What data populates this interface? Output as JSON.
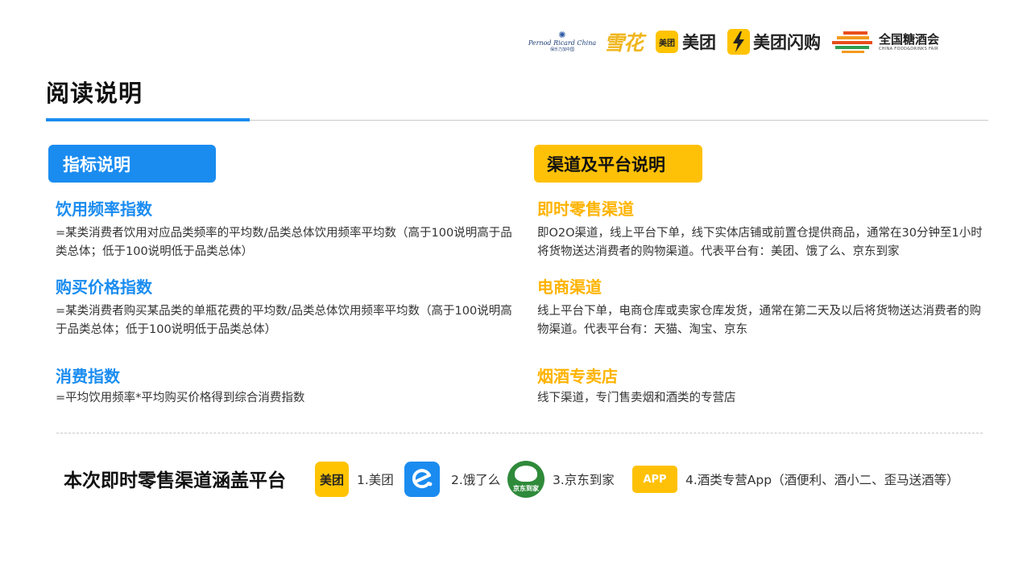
{
  "logos": {
    "pernod_en": "Pernod Ricard China",
    "pernod_cn": "保乐力加中国",
    "snow": "雪花",
    "meituan_badge": "美团",
    "meituan": "美团",
    "flash": "美团闪购",
    "fair_cn": "全国糖酒会",
    "fair_en": "CHINA FOOD&DRINKS FAIR"
  },
  "page": {
    "title": "阅读说明"
  },
  "left_section": {
    "tab": "指标说明",
    "items": [
      {
        "title": "饮用频率指数",
        "desc": "=某类消费者饮用对应品类频率的平均数/品类总体饮用频率平均数（高于100说明高于品类总体；低于100说明低于品类总体）"
      },
      {
        "title": "购买价格指数",
        "desc": "=某类消费者购买某品类的单瓶花费的平均数/品类总体饮用频率平均数（高于100说明高于品类总体；低于100说明低于品类总体）"
      },
      {
        "title": "消费指数",
        "desc": "=平均饮用频率*平均购买价格得到综合消费指数"
      }
    ]
  },
  "right_section": {
    "tab": "渠道及平台说明",
    "items": [
      {
        "title": "即时零售渠道",
        "desc": "即O2O渠道，线上平台下单，线下实体店铺或前置仓提供商品，通常在30分钟至1小时将货物送达消费者的购物渠道。代表平台有：美团、饿了么、京东到家"
      },
      {
        "title": "电商渠道",
        "desc": "线上平台下单，电商仓库或卖家仓库发货，通常在第二天及以后将货物送达消费者的购物渠道。代表平台有：天猫、淘宝、京东"
      },
      {
        "title": "烟酒专卖店",
        "desc": "线下渠道，专门售卖烟和酒类的专营店"
      }
    ]
  },
  "platforms": {
    "heading": "本次即时零售渠道涵盖平台",
    "items": [
      {
        "icon": "meituan-icon",
        "icon_text": "美团",
        "label": "1.美团"
      },
      {
        "icon": "eleme-icon",
        "icon_text": "",
        "label": "2.饿了么"
      },
      {
        "icon": "jddj-icon",
        "icon_text": "京东到家",
        "label": "3.京东到家"
      },
      {
        "icon": "app-icon",
        "icon_text": "APP",
        "label": "4.酒类专营App（酒便利、酒小二、歪马送酒等）"
      }
    ]
  },
  "colors": {
    "blue": "#1a8cf0",
    "yellow": "#ffc107",
    "title_yellow": "#ffb300"
  }
}
